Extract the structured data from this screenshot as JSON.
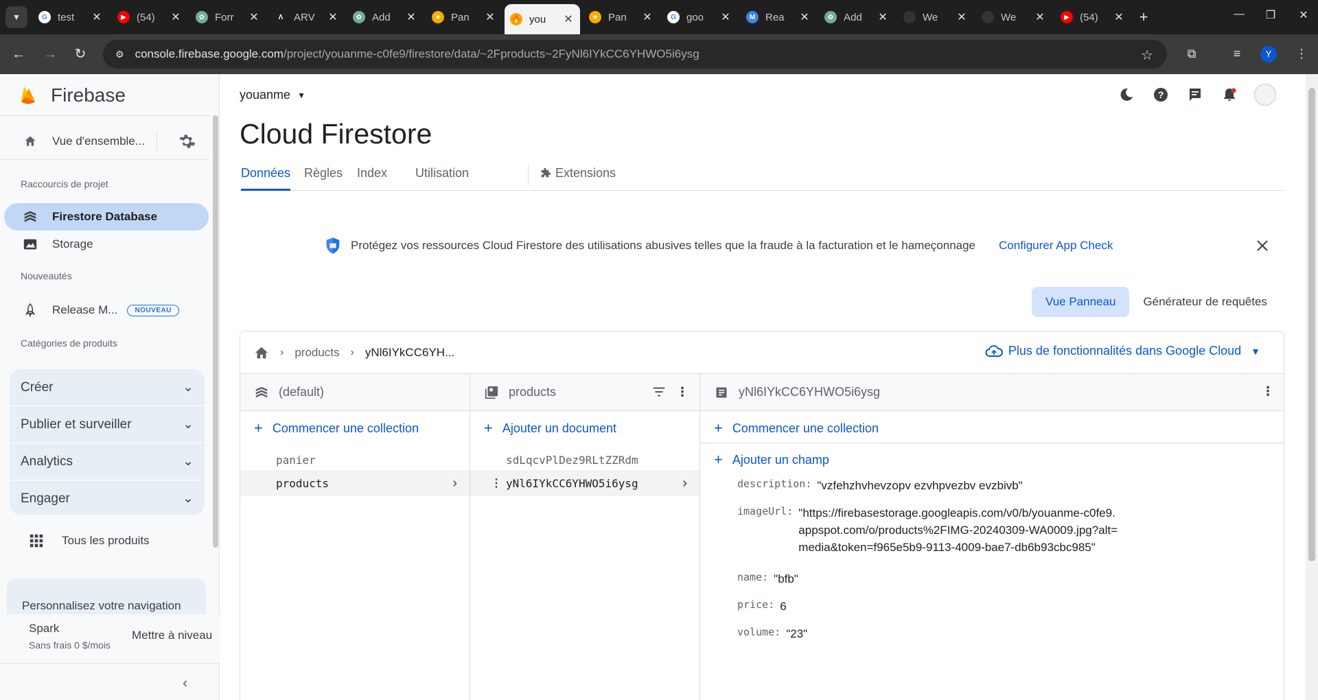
{
  "browser": {
    "tabs": [
      {
        "title": "test",
        "fav_color": "#ffffff",
        "fav_text": "G"
      },
      {
        "title": "(54)",
        "fav_color": "#ff0000",
        "fav_text": "▶"
      },
      {
        "title": "Forr",
        "fav_color": "#74aa9c",
        "fav_text": "✿"
      },
      {
        "title": "ARV",
        "fav_color": "#1f1f1f",
        "fav_text": "Λ"
      },
      {
        "title": "Add",
        "fav_color": "#74aa9c",
        "fav_text": "✿"
      },
      {
        "title": "Pan",
        "fav_color": "#f9ab00",
        "fav_text": "★"
      },
      {
        "title": "you",
        "fav_color": "#ffa000",
        "fav_text": "🔥"
      },
      {
        "title": "Pan",
        "fav_color": "#f9ab00",
        "fav_text": "★"
      },
      {
        "title": "goo",
        "fav_color": "#ffffff",
        "fav_text": "G"
      },
      {
        "title": "Rea",
        "fav_color": "#3b82f6",
        "fav_text": "M"
      },
      {
        "title": "Add",
        "fav_color": "#74aa9c",
        "fav_text": "✿"
      },
      {
        "title": "We",
        "fav_color": "#333333",
        "fav_text": ""
      },
      {
        "title": "We",
        "fav_color": "#333333",
        "fav_text": ""
      },
      {
        "title": "(54)",
        "fav_color": "#ff0000",
        "fav_text": "▶"
      }
    ],
    "url_host": "console.firebase.google.com",
    "url_path": "/project/youanme-c0fe9/firestore/data/~2Fproducts~2FyNl6IYkCC6YHWO5i6ysg",
    "profile_initial": "Y"
  },
  "sidebar": {
    "brand": "Firebase",
    "overview": "Vue d'ensemble...",
    "shortcuts_label": "Raccourcis de projet",
    "firestore": "Firestore Database",
    "storage": "Storage",
    "news_label": "Nouveautés",
    "release": "Release M...",
    "new_badge": "NOUVEAU",
    "categories_label": "Catégories de produits",
    "categories": [
      "Créer",
      "Publier et surveiller",
      "Analytics",
      "Engager"
    ],
    "all_products": "Tous les produits",
    "customize": "Personnalisez votre navigation",
    "plan_name": "Spark",
    "plan_price": "Sans frais 0 $/mois",
    "upgrade": "Mettre à niveau"
  },
  "header": {
    "project": "youanme",
    "title": "Cloud Firestore",
    "tabs": [
      "Données",
      "Règles",
      "Index",
      "Utilisation",
      "Extensions"
    ]
  },
  "banner": {
    "text": "Protégez vos ressources Cloud Firestore des utilisations abusives telles que la fraude à la facturation et le hameçonnage",
    "link": "Configurer App Check"
  },
  "view": {
    "panel_view": "Vue Panneau",
    "query_builder": "Générateur de requêtes"
  },
  "breadcrumb": {
    "collection": "products",
    "document": "yNl6IYkCC6YH..."
  },
  "gcloud_link": "Plus de fonctionnalités dans Google Cloud",
  "columns": {
    "root": {
      "title": "(default)",
      "action": "Commencer une collection",
      "items": [
        "panier",
        "products"
      ]
    },
    "collection": {
      "title": "products",
      "action": "Ajouter un document",
      "items": [
        "sdLqcvPlDez9RLtZZRdm",
        "yNl6IYkCC6YHWO5i6ysg"
      ]
    },
    "document": {
      "title": "yNl6IYkCC6YHWO5i6ysg",
      "action_collection": "Commencer une collection",
      "action_field": "Ajouter un champ",
      "fields": [
        {
          "key": "description:",
          "value": "\"vzfehzhvhevzopv ezvhpvezbv evzbivb\""
        },
        {
          "key": "imageUrl:",
          "value": "\"https://firebasestorage.googleapis.com/v0/b/youanme-c0fe9.appspot.com/o/products%2FIMG-20240309-WA0009.jpg?alt=media&token=f965e5b9-9113-4009-bae7-db6b93cbc985\""
        },
        {
          "key": "name:",
          "value": "\"bfb\""
        },
        {
          "key": "price:",
          "value": "6"
        },
        {
          "key": "volume:",
          "value": "\"23\""
        }
      ]
    }
  },
  "colors": {
    "accent": "#0b57d0",
    "active_nav": "#c2d7f5",
    "firebase_orange": "#ffa000"
  }
}
